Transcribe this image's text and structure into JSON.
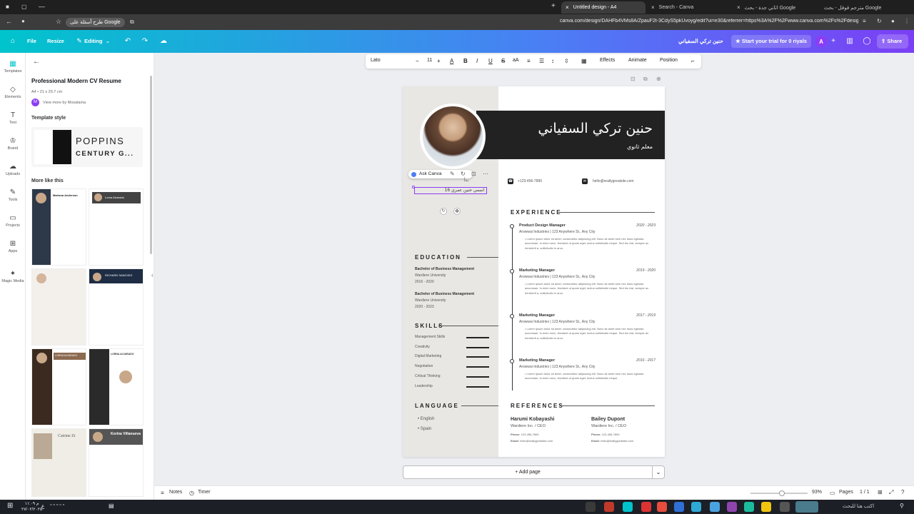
{
  "browser": {
    "tabs": [
      {
        "label": "Untitled design - A4"
      },
      {
        "label": "Search - Canva"
      },
      {
        "label": "اثاني جدة - بحث Google"
      },
      {
        "label": "مترجم قوقل - بحث Google"
      }
    ],
    "google_chip": "طرح أسئلة على Google",
    "url": "canva.com/design/DAHFb4VMs8A/ZpauF2t-3CdyS5pkUvoyg/edit?ui=e30&referrer=https%3A%2F%2Fwww.canva.com%2Fs%2Fdesigns"
  },
  "header": {
    "file": "File",
    "resize": "Resize",
    "editing": "Editing",
    "doc_title": "حنين تركي السفياني",
    "trial": "Start your trial for 0 riyals",
    "avatar": "A",
    "share": "Share"
  },
  "rail": [
    {
      "label": "Templates",
      "icon": "templates-icon"
    },
    {
      "label": "Elements",
      "icon": "elements-icon"
    },
    {
      "label": "Text",
      "icon": "text-icon"
    },
    {
      "label": "Brand",
      "icon": "brand-icon"
    },
    {
      "label": "Uploads",
      "icon": "uploads-icon"
    },
    {
      "label": "Tools",
      "icon": "tools-icon"
    },
    {
      "label": "Projects",
      "icon": "projects-icon"
    },
    {
      "label": "Apps",
      "icon": "apps-icon"
    },
    {
      "label": "Magic Media",
      "icon": "magic-media-icon"
    }
  ],
  "panel": {
    "title": "Professional Modern CV Resume",
    "size": "A4 • 21 x 29.7 cm",
    "author": "View more by Mosalama",
    "style_heading": "Template style",
    "style_font1": "POPPINS",
    "style_font2": "CENTURY G...",
    "more_heading": "More like this",
    "thumb_names": [
      "Mariana Anderson",
      "Lorna Alvarado",
      "",
      "RICHARD SANCHEZ",
      "LORNA ALVARADO",
      "LORNA ALVARADO",
      "Catrine Zi",
      "Korina Villanueva"
    ]
  },
  "toolbar": {
    "font": "Lato",
    "size": "11",
    "effects": "Effects",
    "animate": "Animate",
    "position": "Position"
  },
  "resume": {
    "name": "حنين تركي السفياني",
    "subtitle": "معلم ثانوي",
    "selected_text": "اسمي حنين عمري 16",
    "above_text": "بدأ",
    "ask_canva": "Ask Canva",
    "phone": "+123-456-7890",
    "email": "hello@reallygreatsite.com",
    "education_title": "EDUCATION",
    "education": [
      {
        "degree": "Bachelor of Business Management",
        "school": "Wardiere University",
        "years": "2016 - 2020"
      },
      {
        "degree": "Bachelor of Business Management",
        "school": "Wardiere University",
        "years": "2020 - 2023"
      }
    ],
    "skills_title": "SKILLS",
    "skills": [
      "Management Skills",
      "Creativity",
      "Digital Marketing",
      "Negotiation",
      "Critical Thinking",
      "Leadership"
    ],
    "language_title": "LANGUAGE",
    "languages": [
      "English",
      "Spain"
    ],
    "experience_title": "EXPERIENCE",
    "experience": [
      {
        "role": "Product Design Manager",
        "years": "2020 - 2023",
        "company": "Arowwai Industries | 123 Anywhere St., Any City",
        "desc": "Lorem ipsum dolor sit amet, consectetur adipiscing elit. Nunc sit amet sem nec risus egestas accumsan. In enim nunc, tincidunt ut quam eget, luctus sollicitudin neque. Sed leo nisl, semper ac hendrerit a, sollicitudin in arcu."
      },
      {
        "role": "Marketing Manager",
        "years": "2019 - 2020",
        "company": "Arowwai Industries | 123 Anywhere St., Any City",
        "desc": "Lorem ipsum dolor sit amet, consectetur adipiscing elit. Nunc sit amet sem nec risus egestas accumsan. In enim nunc, tincidunt ut quam eget, luctus sollicitudin neque. Sed leo nisl, semper ac hendrerit a, sollicitudin in arcu."
      },
      {
        "role": "Marketing Manager",
        "years": "2017 - 2019",
        "company": "Arowwai Industries | 123 Anywhere St., Any City",
        "desc": "Lorem ipsum dolor sit amet, consectetur adipiscing elit. Nunc sit amet sem nec risus egestas accumsan. In enim nunc, tincidunt ut quam eget, luctus sollicitudin neque. Sed leo nisl, semper ac hendrerit a, sollicitudin in arcu."
      },
      {
        "role": "Marketing Manager",
        "years": "2016 - 2017",
        "company": "Arowwai Industries | 123 Anywhere St., Any City",
        "desc": "Lorem ipsum dolor sit amet, consectetur adipiscing elit. Nunc sit amet sem nec risus egestas accumsan. In enim nunc, tincidunt ut quam eget, luctus sollicitudin neque."
      }
    ],
    "references_title": "REFERENCES",
    "references": [
      {
        "name": "Harumi Kobayashi",
        "title": "Wardiere Inc. / CEO",
        "phone_label": "Phone:",
        "phone": "123-456-7890",
        "email_label": "Email:",
        "email": "hello@reallygreatsite.com"
      },
      {
        "name": "Bailey Dupont",
        "title": "Wardiere Inc. / CEO",
        "phone_label": "Phone:",
        "phone": "123-456-7890",
        "email_label": "Email:",
        "email": "hello@reallygreatsite.com"
      }
    ]
  },
  "add_page": "+ Add page",
  "bottom": {
    "notes": "Notes",
    "timer": "Timer",
    "zoom": "93%",
    "pages_label": "Pages",
    "pages": "1 / 1"
  },
  "taskbar": {
    "search": "اكتب هنا للبحث",
    "time": "۱۱:۰۹ م",
    "date": "۲۷/۰۲/۲۰۲٥",
    "lang": "ع"
  },
  "colors": {
    "header_start": "#00c4cc",
    "header_end": "#7b3ff5",
    "resume_dark": "#222222",
    "left_column": "#e9e7e4",
    "selection": "#8b3df5"
  }
}
